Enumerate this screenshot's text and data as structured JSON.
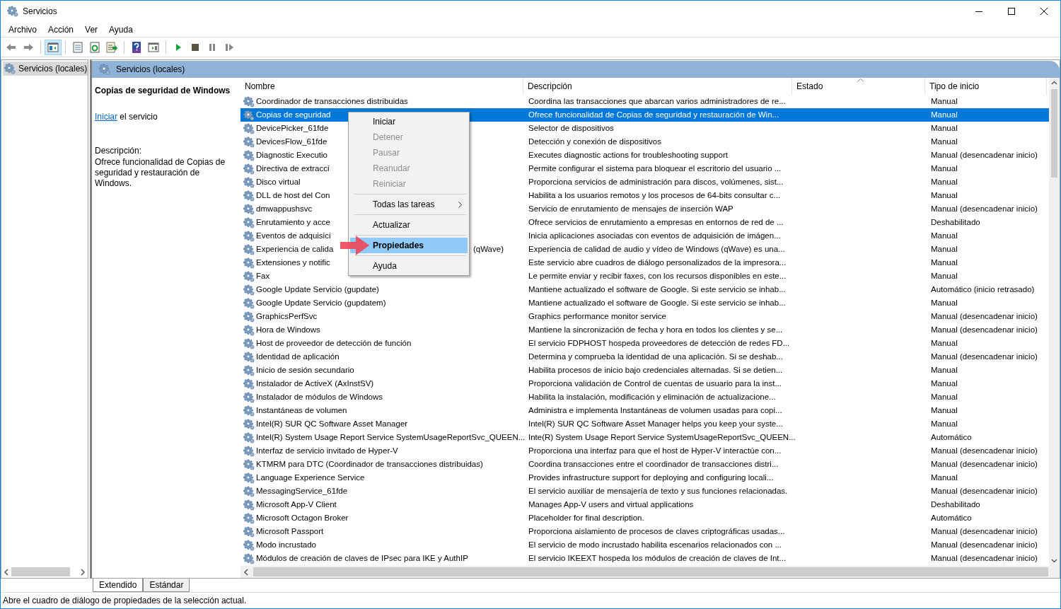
{
  "window": {
    "title": "Servicios"
  },
  "menu_bar": [
    "Archivo",
    "Acción",
    "Ver",
    "Ayuda"
  ],
  "toolbar": [
    {
      "kind": "back",
      "selected": false
    },
    {
      "kind": "forward",
      "selected": false
    },
    {
      "kind": "separator"
    },
    {
      "kind": "tree",
      "selected": true
    },
    {
      "kind": "separator"
    },
    {
      "kind": "properties",
      "selected": false
    },
    {
      "kind": "refresh",
      "selected": false
    },
    {
      "kind": "export",
      "selected": false
    },
    {
      "kind": "separator"
    },
    {
      "kind": "help",
      "selected": false
    },
    {
      "kind": "pane",
      "selected": false
    },
    {
      "kind": "separator"
    },
    {
      "kind": "play",
      "selected": false
    },
    {
      "kind": "stop",
      "selected": false
    },
    {
      "kind": "pause",
      "selected": false
    },
    {
      "kind": "resume",
      "selected": false
    }
  ],
  "tree": {
    "items": [
      {
        "label": "Servicios (locales)",
        "selected": true
      }
    ]
  },
  "panel_header": "Servicios (locales)",
  "details": {
    "title": "Copias de seguridad de Windows",
    "action_link": "Iniciar",
    "action_text": "el servicio",
    "description_label": "Descripción:",
    "description": "Ofrece funcionalidad de Copias de seguridad y restauración de Windows."
  },
  "table": {
    "columns": [
      {
        "label": "Nombre",
        "sorted": false
      },
      {
        "label": "Descripción",
        "sorted": false
      },
      {
        "label": "Estado",
        "sorted": true
      },
      {
        "label": "Tipo de inicio",
        "sorted": false
      }
    ],
    "rows": [
      {
        "name": "Coordinador de transacciones distribuidas",
        "description": "Coordina las transacciones que abarcan varios administradores de re...",
        "startup": "Manual",
        "selected": false
      },
      {
        "name": "Copias de seguridad",
        "description": "Ofrece funcionalidad de Copias de seguridad y restauración de Win...",
        "startup": "Manual",
        "selected": true
      },
      {
        "name": "DevicePicker_61fde",
        "description": "Selector de dispositivos",
        "startup": "Manual",
        "selected": false
      },
      {
        "name": "DevicesFlow_61fde",
        "description": "Detección y conexión de dispositivos",
        "startup": "Manual",
        "selected": false
      },
      {
        "name": "Diagnostic Executio",
        "description": "Executes diagnostic actions for troubleshooting support",
        "startup": "Manual (desencadenar inicio)",
        "selected": false
      },
      {
        "name": "Directiva de extracci",
        "description": "Permite configurar el sistema para bloquear el escritorio del usuario ...",
        "startup": "Manual",
        "selected": false
      },
      {
        "name": "Disco virtual",
        "description": "Proporciona servicios de administración para discos, volúmenes, sist...",
        "startup": "Manual",
        "selected": false
      },
      {
        "name": "DLL de host del Con",
        "description": "Habilita a los usuarios remotos y los procesos de 64-bits consultar c...",
        "startup": "Manual",
        "selected": false
      },
      {
        "name": "dmwappushsvc",
        "description": "Servicio de enrutamiento de mensajes de inserción WAP",
        "startup": "Manual (desencadenar inicio)",
        "selected": false
      },
      {
        "name": "Enrutamiento y acce",
        "description": "Ofrece servicios de enrutamiento a empresas en entornos de red de ...",
        "startup": "Deshabilitado",
        "selected": false
      },
      {
        "name": "Eventos de adquisici",
        "description": "Inicia aplicaciones asociadas con eventos de adquisición de imágen...",
        "startup": "Manual",
        "selected": false
      },
      {
        "name": "Experiencia de calida",
        "name_tail": "(qWave)",
        "description": "Experiencia de calidad de audio y vídeo de Windows (qWave) es una...",
        "startup": "Manual",
        "selected": false
      },
      {
        "name": "Extensiones y notific",
        "description": "Este servicio abre cuadros de diálogo personalizados de la impresora...",
        "startup": "Manual",
        "selected": false
      },
      {
        "name": "Fax",
        "description": "Le permite enviar y recibir faxes, con los recursos disponibles en este...",
        "startup": "Manual",
        "selected": false
      },
      {
        "name": "Google Update Servicio (gupdate)",
        "description": "Mantiene actualizado el software de Google. Si este servicio se inhab...",
        "startup": "Automático (inicio retrasado)",
        "selected": false
      },
      {
        "name": "Google Update Servicio (gupdatem)",
        "description": "Mantiene actualizado el software de Google. Si este servicio se inhab...",
        "startup": "Manual",
        "selected": false
      },
      {
        "name": "GraphicsPerfSvc",
        "description": "Graphics performance monitor service",
        "startup": "Manual (desencadenar inicio)",
        "selected": false
      },
      {
        "name": "Hora de Windows",
        "description": "Mantiene la sincronización de fecha y hora en todos los clientes y se...",
        "startup": "Manual (desencadenar inicio)",
        "selected": false
      },
      {
        "name": "Host de proveedor de detección de función",
        "description": "El servicio FDPHOST hospeda proveedores de detección de redes FD...",
        "startup": "Manual",
        "selected": false
      },
      {
        "name": "Identidad de aplicación",
        "description": "Determina y comprueba la identidad de una aplicación. Si se deshab...",
        "startup": "Manual (desencadenar inicio)",
        "selected": false
      },
      {
        "name": "Inicio de sesión secundario",
        "description": "Habilita procesos de inicio bajo credenciales alternadas. Si se detien...",
        "startup": "Manual",
        "selected": false
      },
      {
        "name": "Instalador de ActiveX (AxInstSV)",
        "description": "Proporciona validación de Control de cuentas de usuario para la inst...",
        "startup": "Manual",
        "selected": false
      },
      {
        "name": "Instalador de módulos de Windows",
        "description": "Habilita la instalación, modificación y eliminación de actualizacione...",
        "startup": "Manual",
        "selected": false
      },
      {
        "name": "Instantáneas de volumen",
        "description": "Administra e implementa Instantáneas de volumen usadas para copi...",
        "startup": "Manual",
        "selected": false
      },
      {
        "name": "Intel(R) SUR QC Software Asset Manager",
        "description": "Intel(R) SUR QC Software Asset Manager helps you keep your syste...",
        "startup": "Manual",
        "selected": false
      },
      {
        "name": "Intel(R) System Usage Report Service SystemUsageReportSvc_QUEEN...",
        "description": "Inte(R) System Usage Report Service SystemUsageReportSvc_QUEEN...",
        "startup": "Automático",
        "selected": false
      },
      {
        "name": "Interfaz de servicio invitado de Hyper-V",
        "description": "Proporciona una interfaz para que el host de Hyper-V interactúe con...",
        "startup": "Manual (desencadenar inicio)",
        "selected": false
      },
      {
        "name": "KTMRM para DTC (Coordinador de transacciones distribuidas)",
        "description": "Coordina transacciones entre el coordinador de transacciones distri...",
        "startup": "Manual (desencadenar inicio)",
        "selected": false
      },
      {
        "name": "Language Experience Service",
        "description": "Provides infrastructure support for deploying and configuring locali...",
        "startup": "Manual",
        "selected": false
      },
      {
        "name": "MessagingService_61fde",
        "description": "El servicio auxiliar de mensajería de texto y sus funciones relacionadas.",
        "startup": "Manual (desencadenar inicio)",
        "selected": false
      },
      {
        "name": "Microsoft App-V Client",
        "description": "Manages App-V users and virtual applications",
        "startup": "Deshabilitado",
        "selected": false
      },
      {
        "name": "Microsoft Octagon Broker",
        "description": "Placeholder for final description.",
        "startup": "Automático",
        "selected": false
      },
      {
        "name": "Microsoft Passport",
        "description": "Proporciona aislamiento de procesos de claves criptográficas usadas...",
        "startup": "Manual (desencadenar inicio)",
        "selected": false
      },
      {
        "name": "Modo incrustado",
        "description": "El servicio de modo incrustado habilita escenarios relacionados con ...",
        "startup": "Manual (desencadenar inicio)",
        "selected": false
      },
      {
        "name": "Módulos de creación de claves de IPsec para IKE y AuthIP",
        "description": "El servicio IKEEXT hospeda los módulos de creación de claves de Int...",
        "startup": "Manual (desencadenar inicio)",
        "selected": false
      }
    ]
  },
  "context_menu": [
    {
      "kind": "item",
      "label": "Iniciar",
      "disabled": false,
      "selected": false,
      "default": false
    },
    {
      "kind": "item",
      "label": "Detener",
      "disabled": true,
      "selected": false,
      "default": false
    },
    {
      "kind": "item",
      "label": "Pausar",
      "disabled": true,
      "selected": false,
      "default": false
    },
    {
      "kind": "item",
      "label": "Reanudar",
      "disabled": true,
      "selected": false,
      "default": false
    },
    {
      "kind": "item",
      "label": "Reiniciar",
      "disabled": true,
      "selected": false,
      "default": false
    },
    {
      "kind": "separator"
    },
    {
      "kind": "submenu",
      "label": "Todas las tareas",
      "disabled": false,
      "selected": false,
      "default": false
    },
    {
      "kind": "separator"
    },
    {
      "kind": "item",
      "label": "Actualizar",
      "disabled": false,
      "selected": false,
      "default": false
    },
    {
      "kind": "separator"
    },
    {
      "kind": "item",
      "label": "Propiedades",
      "disabled": false,
      "selected": true,
      "default": true
    },
    {
      "kind": "separator"
    },
    {
      "kind": "item",
      "label": "Ayuda",
      "disabled": false,
      "selected": false,
      "default": false
    }
  ],
  "view_tabs": [
    {
      "label": "Extendido",
      "selected": true
    },
    {
      "label": "Estándar",
      "selected": false
    }
  ],
  "status_bar": "Abre el cuadro de diálogo de propiedades de la selección actual."
}
